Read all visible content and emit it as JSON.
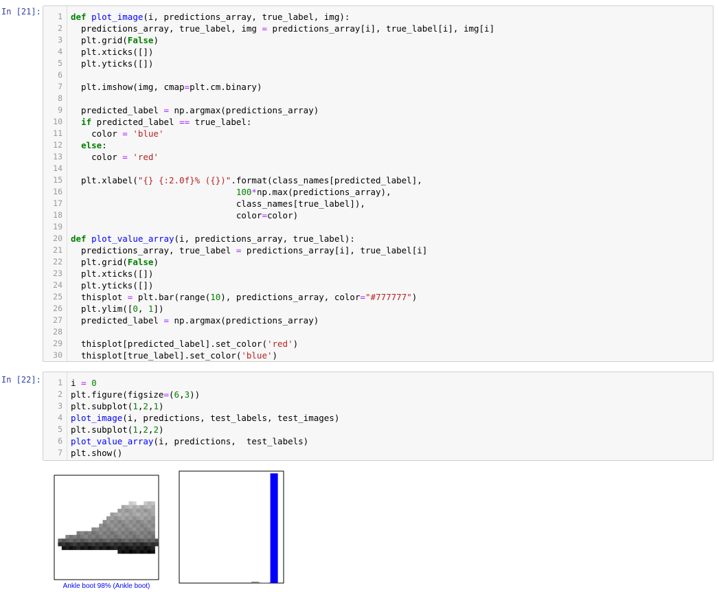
{
  "cells": [
    {
      "prompt": "In [21]:",
      "lines": [
        "def plot_image(i, predictions_array, true_label, img):",
        "  predictions_array, true_label, img = predictions_array[i], true_label[i], img[i]",
        "  plt.grid(False)",
        "  plt.xticks([])",
        "  plt.yticks([])",
        "",
        "  plt.imshow(img, cmap=plt.cm.binary)",
        "",
        "  predicted_label = np.argmax(predictions_array)",
        "  if predicted_label == true_label:",
        "    color = 'blue'",
        "  else:",
        "    color = 'red'",
        "",
        "  plt.xlabel(\"{} {:2.0f}% ({})\".format(class_names[predicted_label],",
        "                                100*np.max(predictions_array),",
        "                                class_names[true_label]),",
        "                                color=color)",
        "",
        "def plot_value_array(i, predictions_array, true_label):",
        "  predictions_array, true_label = predictions_array[i], true_label[i]",
        "  plt.grid(False)",
        "  plt.xticks([])",
        "  plt.yticks([])",
        "  thisplot = plt.bar(range(10), predictions_array, color=\"#777777\")",
        "  plt.ylim([0, 1])",
        "  predicted_label = np.argmax(predictions_array)",
        "",
        "  thisplot[predicted_label].set_color('red')",
        "  thisplot[true_label].set_color('blue')"
      ]
    },
    {
      "prompt": "In [22]:",
      "lines": [
        "i = 0",
        "plt.figure(figsize=(6,3))",
        "plt.subplot(1,2,1)",
        "plot_image(i, predictions, test_labels, test_images)",
        "plt.subplot(1,2,2)",
        "plot_value_array(i, predictions,  test_labels)",
        "plt.show()"
      ]
    }
  ],
  "output": {
    "image_caption": "Ankle boot 98% (Ankle boot)",
    "caption_color": "#0000ff",
    "bar_colors": {
      "default": "#777777",
      "true": "#0000ff"
    },
    "chart_data": {
      "type": "bar",
      "categories": [
        0,
        1,
        2,
        3,
        4,
        5,
        6,
        7,
        8,
        9
      ],
      "values": [
        0.0,
        0.0,
        0.0,
        0.0,
        0.0,
        0.0,
        0.0,
        0.012,
        0.002,
        0.98
      ],
      "ylim": [
        0,
        1
      ],
      "xticks": false,
      "yticks": false
    }
  }
}
